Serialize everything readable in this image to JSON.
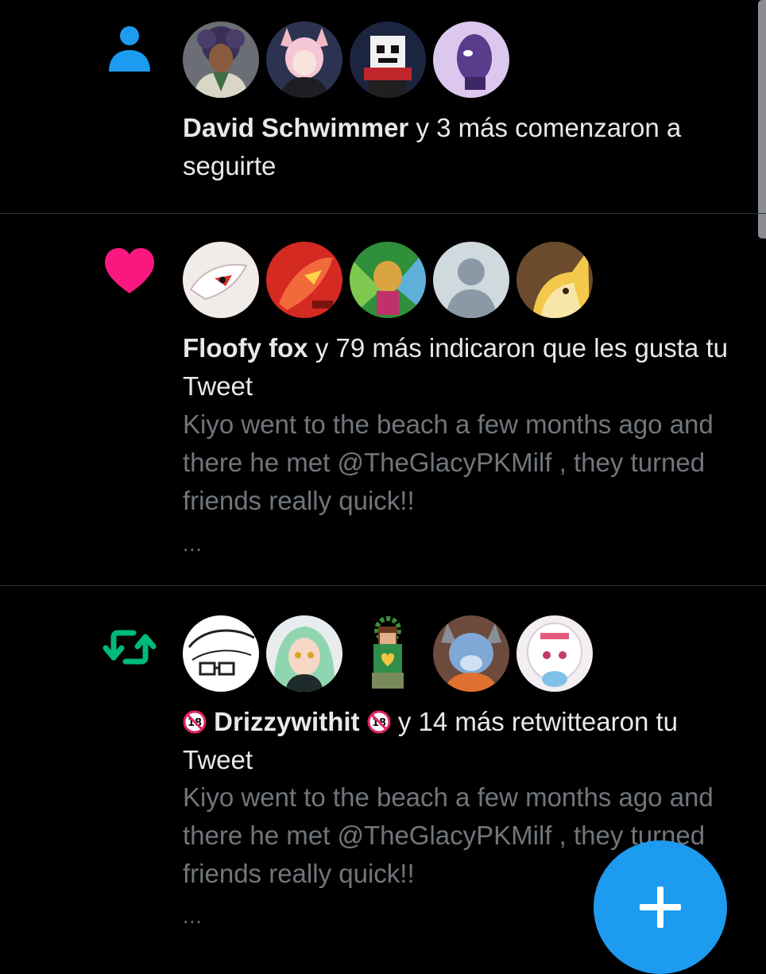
{
  "colors": {
    "background": "#000000",
    "follow_icon": "#1d9bf0",
    "like_icon": "#f91880",
    "retweet_icon": "#00ba7c",
    "divider": "#2f3336",
    "primary_text": "#e7e9ea",
    "secondary_text": "#71767b",
    "fab": "#1d9bf0"
  },
  "notifications": [
    {
      "type": "follow",
      "icon": "person-icon",
      "avatars": [
        "avatar-curly-hair-guy",
        "avatar-pink-fox-girl",
        "avatar-pixel-skull",
        "avatar-purple-creature"
      ],
      "actor": "David Schwimmer",
      "action": " y 3 más comenzaron a seguirte"
    },
    {
      "type": "like",
      "icon": "heart-icon",
      "avatars": [
        "avatar-white-fox",
        "avatar-red-dragon",
        "avatar-green-cat",
        "avatar-default-placeholder",
        "avatar-orange-fox"
      ],
      "actor": "Floofy fox",
      "action": " y 79 más indicaron que les gusta tu Tweet",
      "snippet": "Kiyo went to the beach a few months ago and there he met @TheGlacyPKMilf , they turned friends really quick!!",
      "ellipsis": "..."
    },
    {
      "type": "retweet",
      "icon": "retweet-icon",
      "avatars": [
        "avatar-sketch-glasses",
        "avatar-green-hair-girl",
        "avatar-pixel-boy",
        "avatar-blue-creature",
        "avatar-white-hair-girl"
      ],
      "actor_prefix_badge": "18",
      "actor": "Drizzywithit",
      "actor_suffix_badge": "18",
      "action": " y 14 más retwittearon tu Tweet",
      "snippet": "Kiyo went to the beach a few months ago and there he met @TheGlacyPKMilf , they turned friends really quick!!",
      "ellipsis": "..."
    }
  ],
  "fab": {
    "icon": "plus-icon",
    "label": "+"
  }
}
